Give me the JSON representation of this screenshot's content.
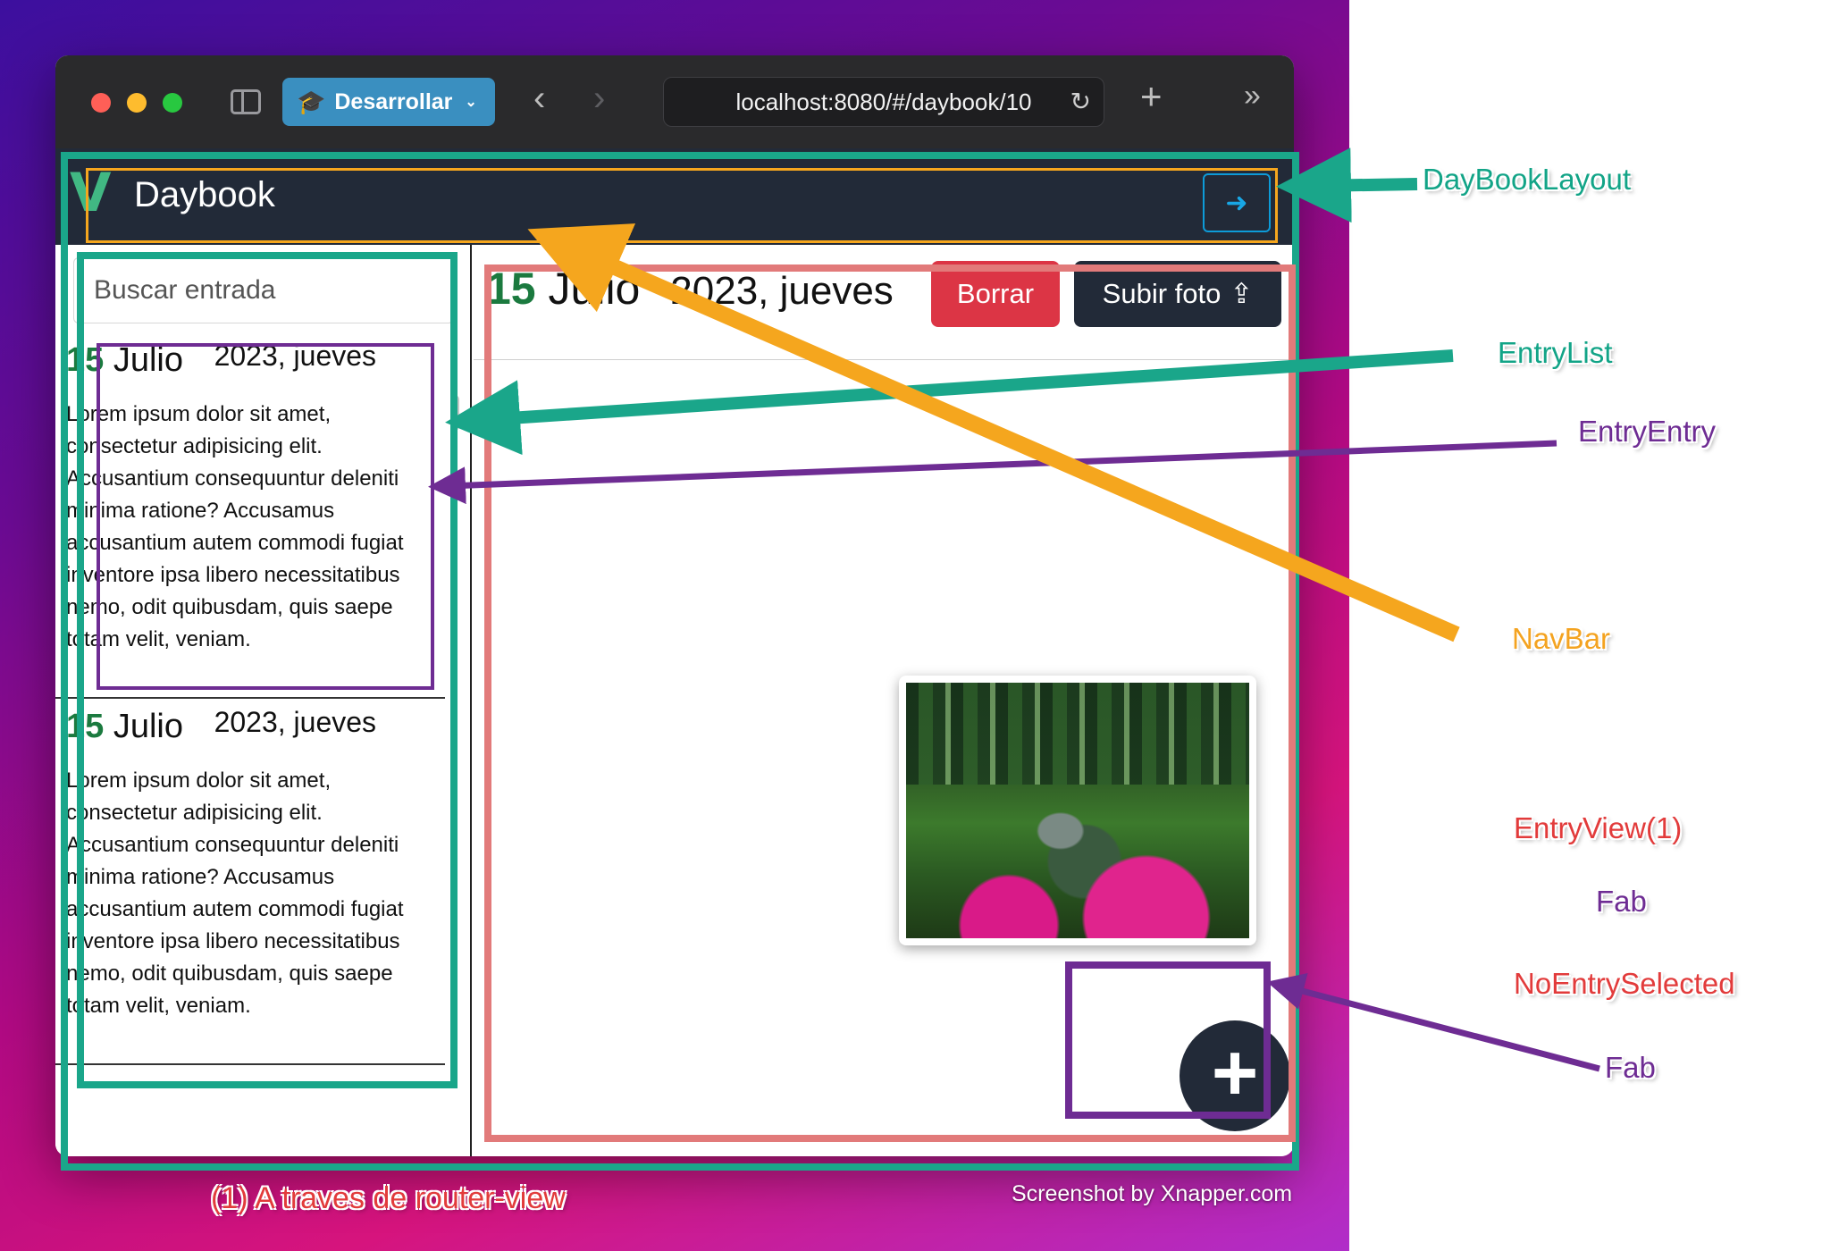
{
  "browser": {
    "dev_menu_label": "Desarrollar",
    "url": "localhost:8080/#/daybook/10"
  },
  "app": {
    "brand": "Daybook",
    "logo_glyph": "V",
    "search_placeholder": "Buscar entrada",
    "entries": [
      {
        "day": "15",
        "month": "Julio",
        "year_weekday": "2023, jueves",
        "text": "Lorem ipsum dolor sit amet, consectetur adipisicing elit. Accusantium consequuntur deleniti minima ratione? Accusamus accusantium autem commodi fugiat inventore ipsa libero necessitatibus nemo, odit quibusdam, quis saepe totam velit, veniam."
      },
      {
        "day": "15",
        "month": "Julio",
        "year_weekday": "2023, jueves",
        "text": "Lorem ipsum dolor sit amet, consectetur adipisicing elit. Accusantium consequuntur deleniti minima ratione? Accusamus accusantium autem commodi fugiat inventore ipsa libero necessitatibus nemo, odit quibusdam, quis saepe totam velit, veniam."
      }
    ],
    "view": {
      "day": "15",
      "month": "Julio",
      "year_weekday": "2023, jueves",
      "delete_label": "Borrar",
      "upload_label": "Subir foto"
    },
    "fab_label": "+"
  },
  "annotations": {
    "daybook_layout": "DayBookLayout",
    "entry_list": "EntryList",
    "entry_entry": "EntryEntry",
    "navbar": "NavBar",
    "entry_view": "EntryView(1)",
    "fab_1": "Fab",
    "no_entry_selected": "NoEntrySelected",
    "fab_2": "Fab",
    "router_note": "(1) A traves de router-view"
  },
  "credit": "Screenshot by Xnapper.com",
  "colors": {
    "annotation_green": "#1aa68a",
    "annotation_purple": "#6e2c93",
    "annotation_orange": "#f5a61e",
    "annotation_red": "#e27a7a",
    "navbar_bg": "#222a38",
    "delete_red": "#dc3545"
  }
}
